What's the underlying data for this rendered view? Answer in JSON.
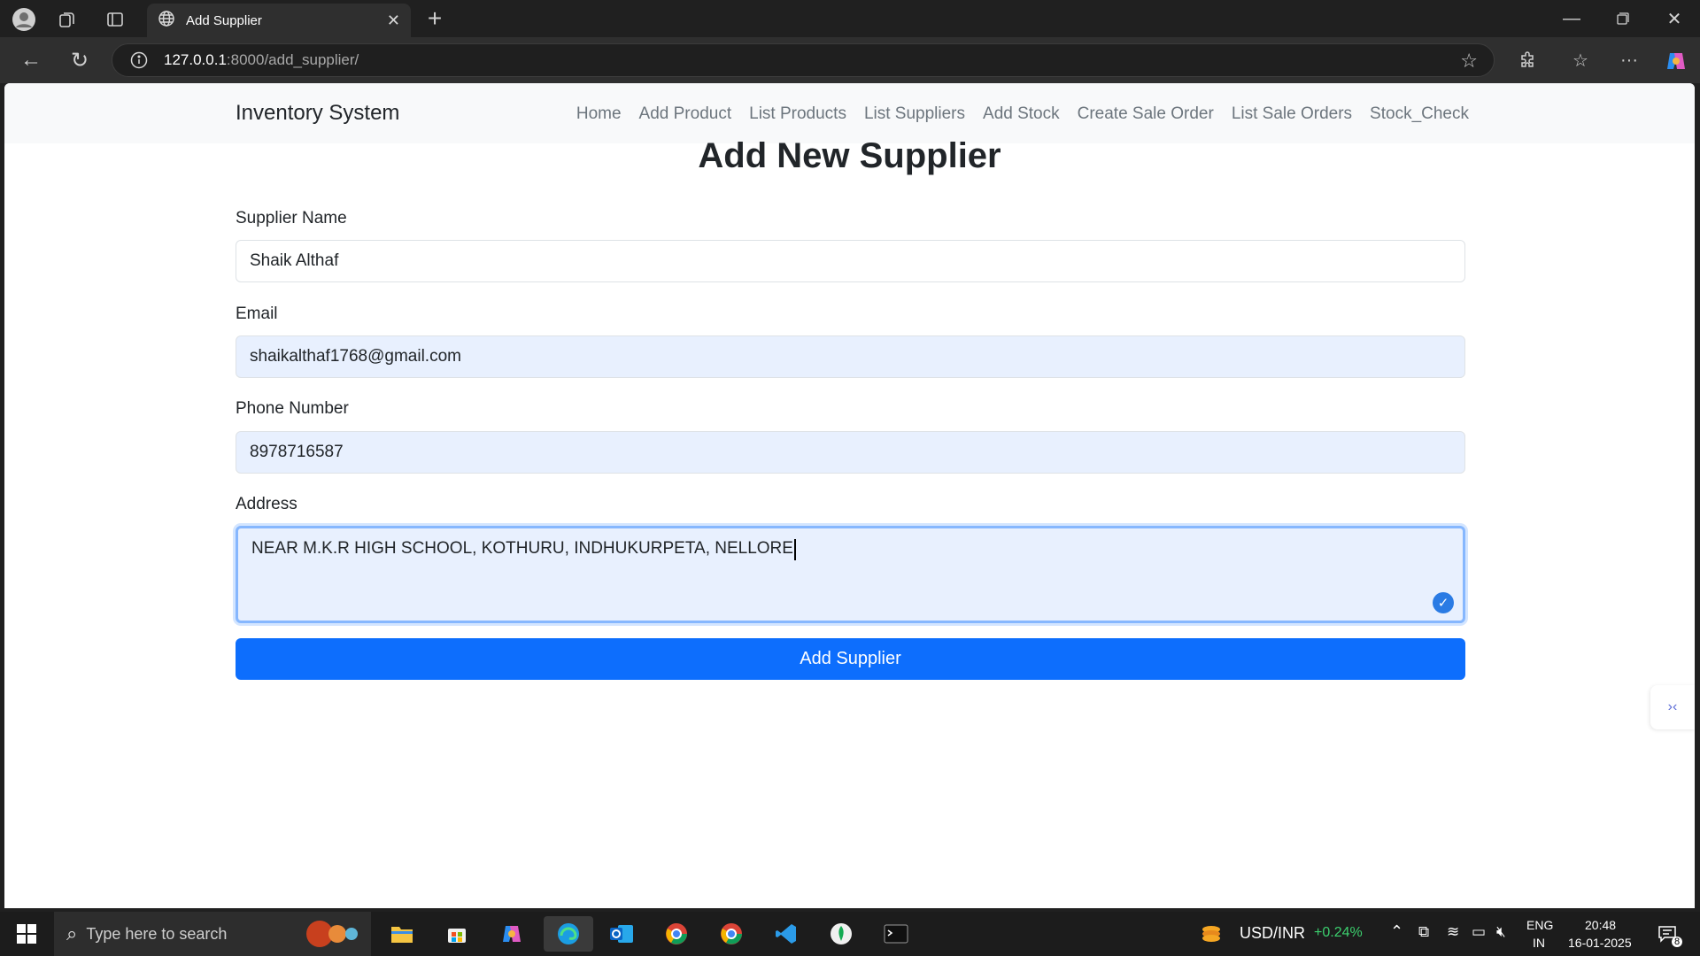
{
  "browser": {
    "tab_title": "Add Supplier",
    "url_host": "127.0.0.1",
    "url_path": ":8000/add_supplier/"
  },
  "navbar": {
    "brand": "Inventory System",
    "links": [
      "Home",
      "Add Product",
      "List Products",
      "List Suppliers",
      "Add Stock",
      "Create Sale Order",
      "List Sale Orders",
      "Stock_Check"
    ]
  },
  "form": {
    "title": "Add New Supplier",
    "name_label": "Supplier Name",
    "name_value": "Shaik Althaf",
    "email_label": "Email",
    "email_value": "shaikalthaf1768@gmail.com",
    "phone_label": "Phone Number",
    "phone_value": "8978716587",
    "address_label": "Address",
    "address_value": "NEAR M.K.R HIGH SCHOOL, KOTHURU, INDHUKURPETA, NELLORE",
    "submit_label": "Add Supplier"
  },
  "taskbar": {
    "search_placeholder": "Type here to search",
    "ticker": "USD/INR",
    "ticker_change": "+0.24%",
    "lang_top": "ENG",
    "lang_bottom": "IN",
    "time": "20:48",
    "date": "16-01-2025",
    "notifications": "8"
  },
  "colors": {
    "primary": "#0d6efd",
    "autofill": "#e8f0fe",
    "ticker_up": "#3ccf6e"
  }
}
